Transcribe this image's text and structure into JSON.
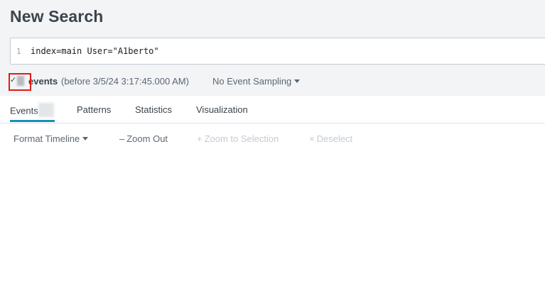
{
  "header": {
    "title": "New Search"
  },
  "search": {
    "line_number": "1",
    "query": "index=main User=\"A1berto\""
  },
  "status": {
    "check_glyph": "✓",
    "events_label": "events",
    "time_label": "(before 3/5/24 3:17:45.000 AM)",
    "sampling_label": "No Event Sampling"
  },
  "tabs": [
    {
      "label": "Events",
      "active": true
    },
    {
      "label": "Patterns",
      "active": false
    },
    {
      "label": "Statistics",
      "active": false
    },
    {
      "label": "Visualization",
      "active": false
    }
  ],
  "timeline_toolbar": {
    "format_label": "Format Timeline",
    "zoom_out_icon": "–",
    "zoom_out_label": "Zoom Out",
    "zoom_selection_icon": "+",
    "zoom_selection_label": "Zoom to Selection",
    "deselect_icon": "×",
    "deselect_label": "Deselect"
  },
  "colors": {
    "accent": "#1a8fb5",
    "highlight": "#e11a1a",
    "header_bg": "#f2f4f5",
    "disabled_text": "#c3cbd4"
  }
}
